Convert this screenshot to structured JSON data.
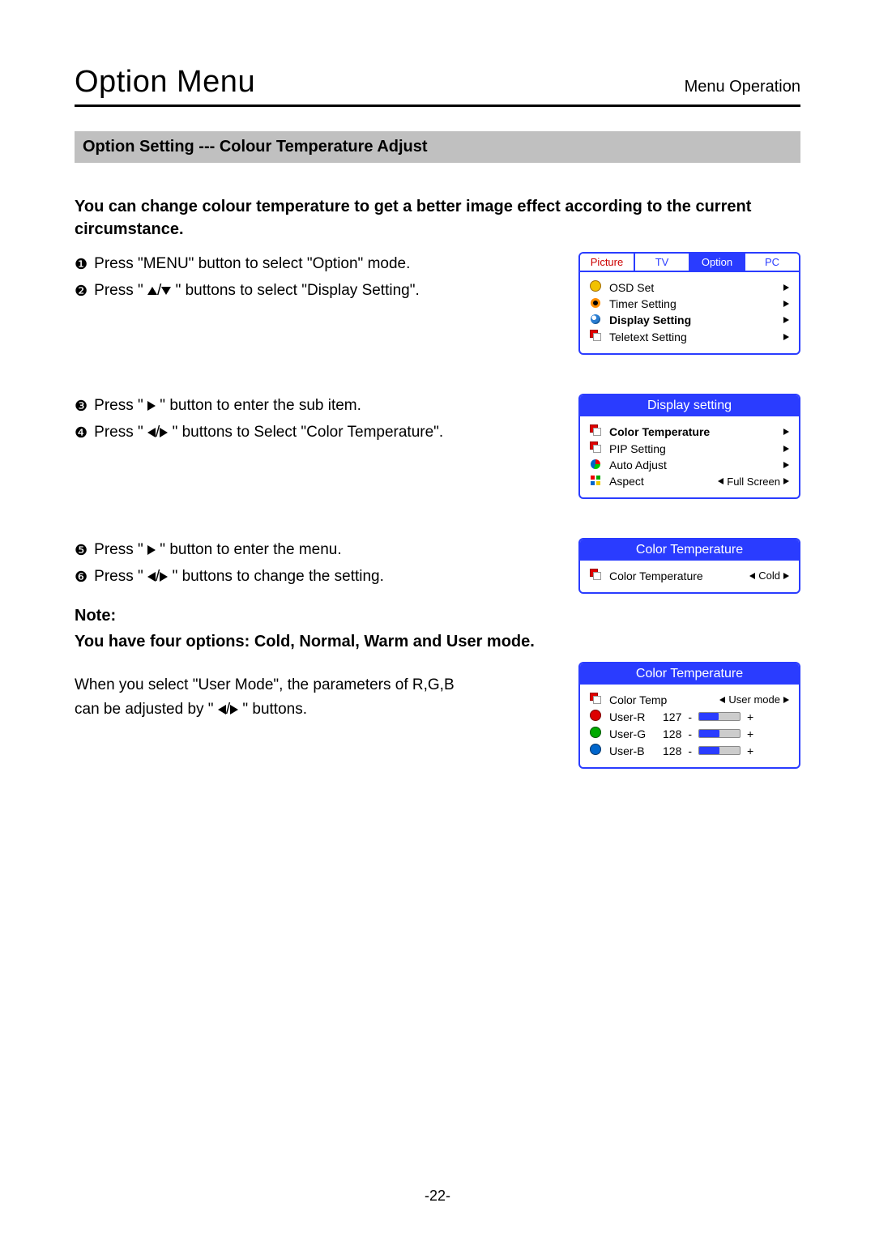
{
  "header": {
    "title": "Option Menu",
    "subtitle": "Menu Operation"
  },
  "section_bar": "Option Setting --- Colour Temperature Adjust",
  "intro": "You can change colour temperature to get a better image effect according to the current circumstance.",
  "steps1": [
    {
      "n": "❶",
      "t": "Press \"MENU\" button to select \"Option\" mode."
    },
    {
      "n": "❷",
      "t_pre": "Press \" ",
      "t_post": " \" buttons to select \"Display Setting\".",
      "arrows": "updown"
    }
  ],
  "steps2": [
    {
      "n": "❸",
      "t_pre": "Press \" ",
      "t_post": " \" button to enter the sub item.",
      "arrows": "right"
    },
    {
      "n": "❹",
      "t_pre": "Press \" ",
      "t_post": " \" buttons to Select \"Color Temperature\".",
      "arrows": "leftright"
    }
  ],
  "steps3": [
    {
      "n": "❺",
      "t_pre": "Press \" ",
      "t_post": " \" button to enter the menu.",
      "arrows": "right"
    },
    {
      "n": "❻",
      "t_pre": "Press \" ",
      "t_post": " \" buttons to change the setting.",
      "arrows": "leftright"
    }
  ],
  "note_label": "Note:",
  "note_line": "You have four options: Cold, Normal, Warm and User mode.",
  "usermode_text_pre": "When you select \"User Mode\", the parameters of R,G,B can be adjusted by \" ",
  "usermode_text_post": " \" buttons.",
  "osd_main": {
    "tabs": [
      "Picture",
      "TV",
      "Option",
      "PC"
    ],
    "active_tab": 2,
    "rows": [
      {
        "icon": "dot-yellow",
        "label": "OSD Set",
        "bold": false
      },
      {
        "icon": "ring-orange",
        "label": "Timer Setting",
        "bold": false
      },
      {
        "icon": "globe",
        "label": "Display Setting",
        "bold": true
      },
      {
        "icon": "squares",
        "label": "Teletext Setting",
        "bold": false
      }
    ]
  },
  "osd_display": {
    "title": "Display setting",
    "rows": [
      {
        "icon": "squares",
        "label": "Color Temperature",
        "bold": true,
        "val": null,
        "arrow": "right"
      },
      {
        "icon": "squares",
        "label": "PIP Setting",
        "bold": false,
        "val": null,
        "arrow": "right"
      },
      {
        "icon": "pie",
        "label": "Auto Adjust",
        "bold": false,
        "val": null,
        "arrow": "right"
      },
      {
        "icon": "grid4",
        "label": "Aspect",
        "bold": false,
        "val": "Full Screen",
        "arrow": "both"
      }
    ]
  },
  "osd_ct": {
    "title": "Color Temperature",
    "row": {
      "icon": "squares",
      "label": "Color Temperature",
      "val": "Cold"
    }
  },
  "osd_user": {
    "title": "Color Temperature",
    "top": {
      "icon": "squares",
      "label": "Color Temp",
      "val": "User mode"
    },
    "sliders": [
      {
        "icon": "rgb-r",
        "label": "User-R",
        "num": "127",
        "fill": "48%"
      },
      {
        "icon": "rgb-g",
        "label": "User-G",
        "num": "128",
        "fill": "50%"
      },
      {
        "icon": "rgb-b",
        "label": "User-B",
        "num": "128",
        "fill": "50%"
      }
    ]
  },
  "page_number": "-22-"
}
